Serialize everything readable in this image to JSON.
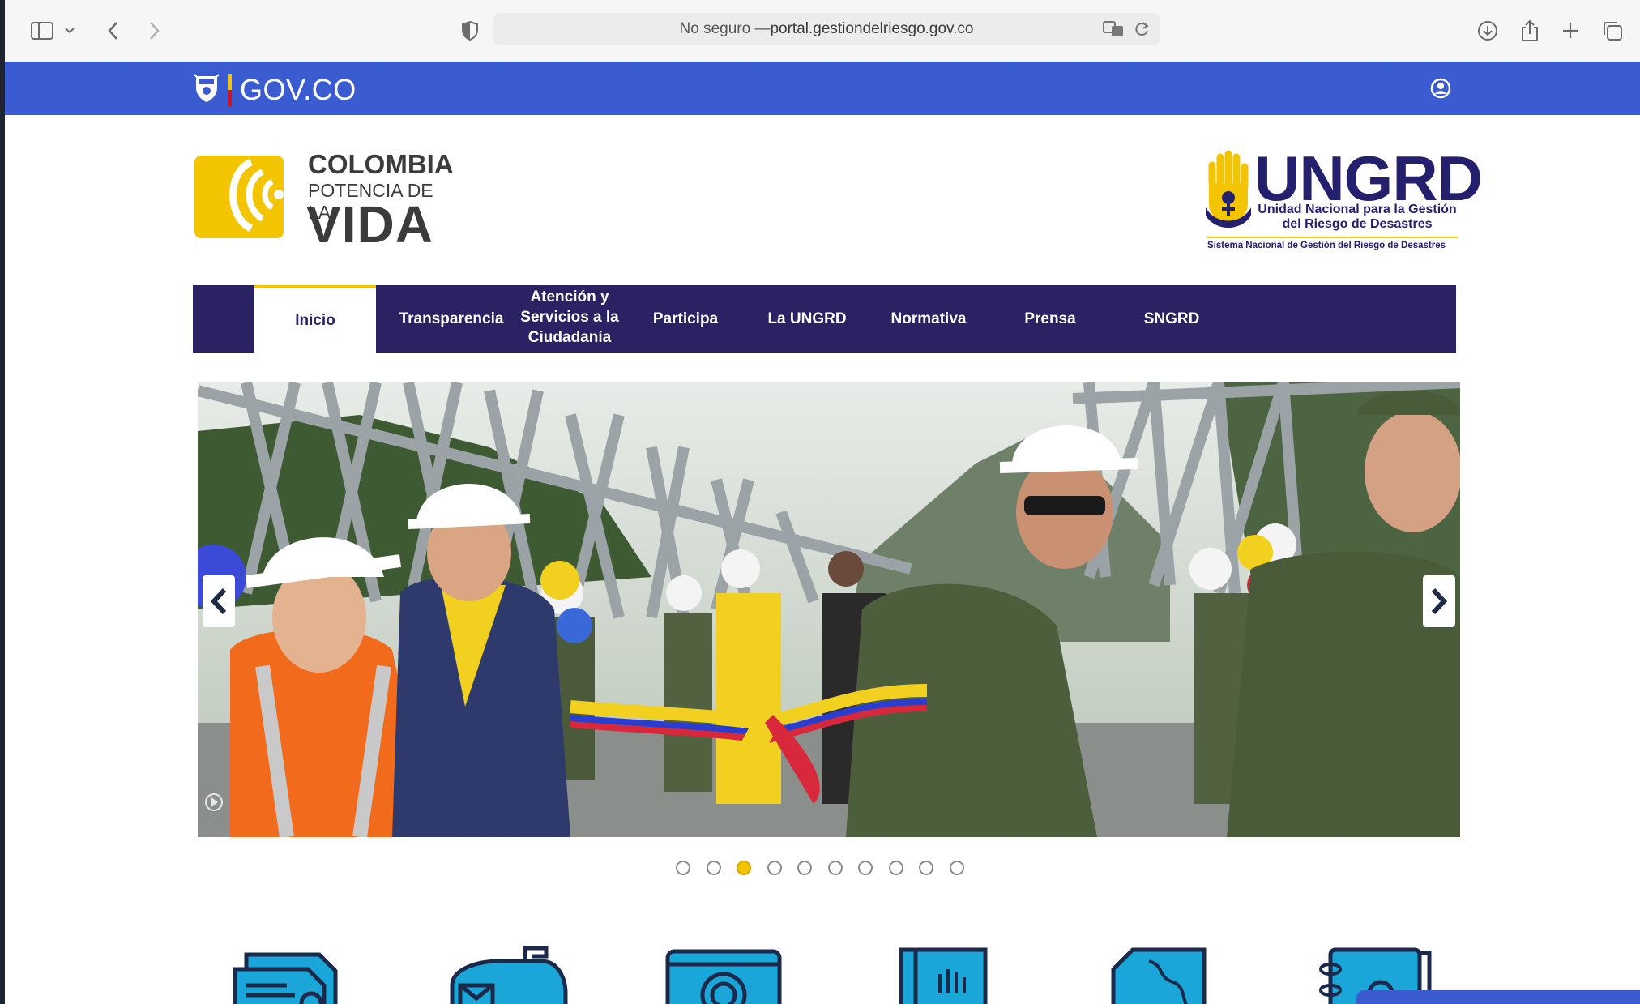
{
  "browser": {
    "address_prefix": "No seguro — ",
    "address_domain": "portal.gestiondelriesgo.gov.co"
  },
  "govbar": {
    "label": "GOV.CO",
    "color": "#3b5bd0"
  },
  "header": {
    "colombia_logo": {
      "line1": "COLOMBIA",
      "line2": "POTENCIA DE LA",
      "line3": "VIDA"
    },
    "ungrd_logo": {
      "title": "UNGRD",
      "subtitle": "Unidad Nacional para la Gestión del Riesgo de Desastres",
      "tagline": "Sistema Nacional de Gestión del Riesgo de Desastres"
    }
  },
  "nav": {
    "items": [
      {
        "label": "Inicio"
      },
      {
        "label": "Transparencia"
      },
      {
        "label": "Atención y Servicios a la Ciudadanía"
      },
      {
        "label": "Participa"
      },
      {
        "label": "La UNGRD"
      },
      {
        "label": "Normativa"
      },
      {
        "label": "Prensa"
      },
      {
        "label": "SNGRD"
      }
    ],
    "active_index": 0,
    "color": "#2b2264",
    "accent": "#f2c500"
  },
  "carousel": {
    "slide_count": 10,
    "active_slide": 3,
    "image": "ribbon-cutting-bridge-photo"
  },
  "quick_links": {
    "icons": [
      "document-icon",
      "mailbox-icon",
      "camera-icon",
      "book-icon",
      "map-icon",
      "binder-icon"
    ],
    "color": "#1aa6d8"
  }
}
